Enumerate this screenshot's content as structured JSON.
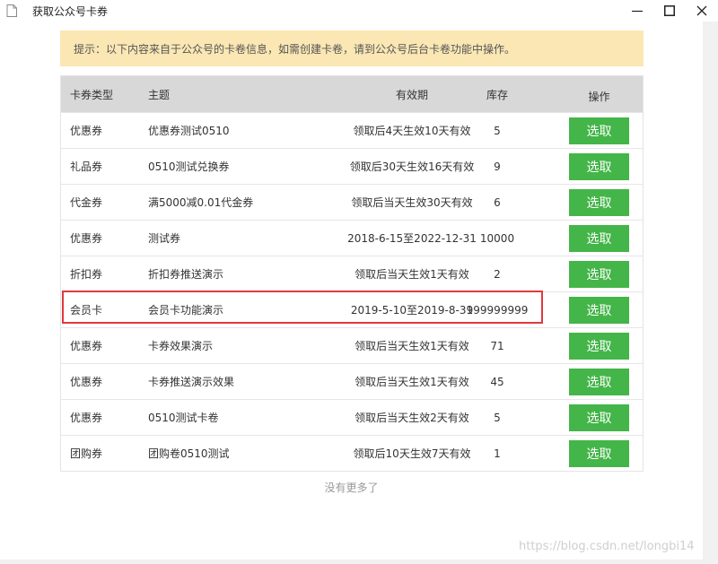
{
  "window": {
    "title": "获取公众号卡券"
  },
  "notice": {
    "text": "提示：以下内容来自于公众号的卡卷信息，如需创建卡卷，请到公众号后台卡卷功能中操作。"
  },
  "table": {
    "headers": {
      "type": "卡券类型",
      "name": "主题",
      "valid": "有效期",
      "stock": "库存",
      "op": "操作"
    },
    "rows": [
      {
        "type": "优惠券",
        "name": "优惠券测试0510",
        "valid": "领取后4天生效10天有效",
        "stock": "5",
        "action": "选取"
      },
      {
        "type": "礼品券",
        "name": "0510测试兑换券",
        "valid": "领取后30天生效16天有效",
        "stock": "9",
        "action": "选取"
      },
      {
        "type": "代金券",
        "name": "满5000减0.01代金券",
        "valid": "领取后当天生效30天有效",
        "stock": "6",
        "action": "选取"
      },
      {
        "type": "优惠券",
        "name": "测试券",
        "valid": "2018-6-15至2022-12-31",
        "stock": "10000",
        "action": "选取"
      },
      {
        "type": "折扣券",
        "name": "折扣券推送演示",
        "valid": "领取后当天生效1天有效",
        "stock": "2",
        "action": "选取"
      },
      {
        "type": "会员卡",
        "name": "会员卡功能演示",
        "valid": "2019-5-10至2019-8-31",
        "stock": "999999999",
        "action": "选取"
      },
      {
        "type": "优惠券",
        "name": "卡券效果演示",
        "valid": "领取后当天生效1天有效",
        "stock": "71",
        "action": "选取"
      },
      {
        "type": "优惠券",
        "name": "卡券推送演示效果",
        "valid": "领取后当天生效1天有效",
        "stock": "45",
        "action": "选取"
      },
      {
        "type": "优惠券",
        "name": "0510测试卡卷",
        "valid": "领取后当天生效2天有效",
        "stock": "5",
        "action": "选取"
      },
      {
        "type": "团购券",
        "name": "团购卷0510测试",
        "valid": "领取后10天生效7天有效",
        "stock": "1",
        "action": "选取"
      }
    ]
  },
  "footer": {
    "no_more": "没有更多了"
  },
  "watermark": {
    "text": "https://blog.csdn.net/longbi14"
  },
  "colors": {
    "select_button": "#44b549",
    "notice_bg": "#fae7b3",
    "highlight_border": "#e0393e"
  },
  "icons": {
    "window": "document-icon",
    "minimize": "minimize-icon",
    "maximize": "maximize-icon",
    "close": "close-icon"
  }
}
